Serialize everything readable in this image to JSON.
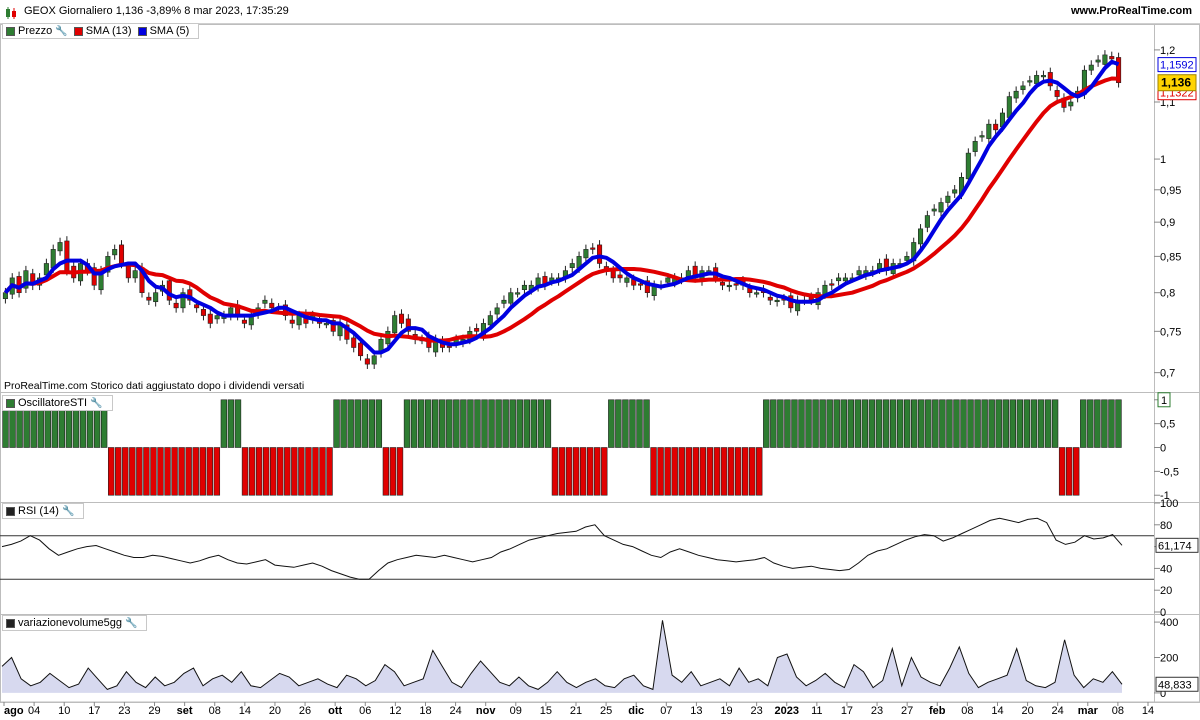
{
  "header": {
    "title": "GEOX Giornaliero 1,136 -3,89% 8 mar 2023, 17:35:29",
    "site": "www.ProRealTime.com"
  },
  "price_panel": {
    "legend": [
      {
        "label": "Prezzo",
        "color": "#2e7d32"
      },
      {
        "label": "SMA (13)",
        "color": "#e00000"
      },
      {
        "label": "SMA (5)",
        "color": "#0000e0"
      }
    ],
    "note": "ProRealTime.com  Storico dati aggiustato dopo i dividendi versati",
    "last_price": "1,136",
    "sma5_last": "1,1592",
    "sma13_last": "1,1322"
  },
  "sti_panel": {
    "legend": "OscillatoreSTI",
    "last_value": "1"
  },
  "rsi_panel": {
    "legend": "RSI (14)",
    "last_value": "61,174"
  },
  "volume_panel": {
    "legend": "variazionevolume5gg",
    "last_value": "48,833"
  },
  "x_axis": {
    "labels": [
      "ago",
      "04",
      "10",
      "17",
      "23",
      "29",
      "set",
      "08",
      "14",
      "20",
      "26",
      "ott",
      "06",
      "12",
      "18",
      "24",
      "nov",
      "09",
      "15",
      "21",
      "25",
      "dic",
      "07",
      "13",
      "19",
      "23",
      "2023",
      "11",
      "17",
      "23",
      "27",
      "feb",
      "08",
      "14",
      "20",
      "24",
      "mar",
      "08",
      "14"
    ]
  },
  "colors": {
    "up": "#2e7d32",
    "down": "#e00000",
    "sma13": "#e00000",
    "sma5": "#0000e0",
    "volume_fill": "#d7d9ef"
  },
  "chart_data": [
    {
      "type": "candlestick",
      "title": "GEOX Giornaliero",
      "y_ticks": [
        "1,2",
        "1,1",
        "1",
        "0,95",
        "0,9",
        "0,85",
        "0,8",
        "0,75",
        "0,7"
      ],
      "ylim": [
        0.68,
        1.22
      ],
      "y_scale": "log",
      "close": [
        0.8,
        0.82,
        0.8,
        0.83,
        0.81,
        0.82,
        0.84,
        0.86,
        0.87,
        0.83,
        0.82,
        0.84,
        0.83,
        0.81,
        0.83,
        0.85,
        0.86,
        0.84,
        0.82,
        0.83,
        0.8,
        0.79,
        0.8,
        0.81,
        0.79,
        0.78,
        0.8,
        0.79,
        0.78,
        0.77,
        0.76,
        0.77,
        0.77,
        0.78,
        0.77,
        0.76,
        0.77,
        0.78,
        0.79,
        0.78,
        0.78,
        0.77,
        0.76,
        0.77,
        0.76,
        0.77,
        0.76,
        0.76,
        0.75,
        0.76,
        0.74,
        0.73,
        0.72,
        0.71,
        0.72,
        0.74,
        0.75,
        0.77,
        0.76,
        0.75,
        0.74,
        0.74,
        0.73,
        0.74,
        0.73,
        0.73,
        0.74,
        0.74,
        0.75,
        0.75,
        0.76,
        0.77,
        0.78,
        0.79,
        0.8,
        0.8,
        0.81,
        0.81,
        0.82,
        0.81,
        0.82,
        0.82,
        0.83,
        0.84,
        0.85,
        0.86,
        0.86,
        0.84,
        0.83,
        0.82,
        0.82,
        0.82,
        0.81,
        0.81,
        0.8,
        0.81,
        0.81,
        0.82,
        0.82,
        0.82,
        0.83,
        0.82,
        0.83,
        0.83,
        0.82,
        0.81,
        0.81,
        0.81,
        0.81,
        0.8,
        0.8,
        0.8,
        0.79,
        0.79,
        0.79,
        0.78,
        0.79,
        0.79,
        0.79,
        0.8,
        0.81,
        0.81,
        0.82,
        0.82,
        0.82,
        0.83,
        0.83,
        0.83,
        0.84,
        0.83,
        0.84,
        0.84,
        0.85,
        0.87,
        0.89,
        0.91,
        0.92,
        0.93,
        0.94,
        0.95,
        0.97,
        1.01,
        1.03,
        1.04,
        1.06,
        1.05,
        1.08,
        1.11,
        1.12,
        1.13,
        1.14,
        1.15,
        1.15,
        1.13,
        1.11,
        1.09,
        1.1,
        1.12,
        1.16,
        1.17,
        1.18,
        1.19,
        1.182,
        1.136
      ],
      "sma13_last": 1.1322,
      "sma5_last": 1.1592
    },
    {
      "type": "bar",
      "title": "OscillatoreSTI",
      "y_ticks": [
        "1",
        "0,5",
        "0",
        "-0,5",
        "-1"
      ],
      "ylim": [
        -1.1,
        1.1
      ],
      "sign_runs": [
        [
          1,
          15
        ],
        [
          -1,
          16
        ],
        [
          1,
          3
        ],
        [
          -1,
          13
        ],
        [
          1,
          7
        ],
        [
          -1,
          3
        ],
        [
          1,
          21
        ],
        [
          -1,
          8
        ],
        [
          1,
          6
        ],
        [
          -1,
          16
        ],
        [
          1,
          42
        ],
        [
          -1,
          3
        ],
        [
          1,
          6
        ]
      ]
    },
    {
      "type": "line",
      "title": "RSI (14)",
      "y_ticks": [
        "100",
        "80",
        "60",
        "40",
        "20",
        "0"
      ],
      "ylim": [
        0,
        100
      ],
      "reference_lines": [
        70,
        30
      ],
      "values": [
        60,
        62,
        65,
        70,
        66,
        58,
        52,
        55,
        58,
        60,
        61,
        58,
        55,
        52,
        50,
        50,
        52,
        51,
        49,
        47,
        45,
        47,
        50,
        52,
        48,
        45,
        44,
        46,
        48,
        43,
        42,
        41,
        43,
        45,
        42,
        38,
        35,
        32,
        30,
        30,
        38,
        45,
        48,
        50,
        52,
        51,
        50,
        52,
        50,
        48,
        46,
        48,
        50,
        55,
        58,
        62,
        66,
        68,
        70,
        72,
        73,
        74,
        78,
        80,
        70,
        66,
        62,
        60,
        56,
        52,
        50,
        55,
        58,
        55,
        52,
        50,
        48,
        47,
        46,
        47,
        48,
        50,
        45,
        42,
        40,
        41,
        42,
        40,
        39,
        38,
        39,
        45,
        52,
        56,
        58,
        62,
        66,
        69,
        71,
        70,
        65,
        68,
        72,
        76,
        80,
        84,
        86,
        84,
        82,
        85,
        86,
        82,
        66,
        62,
        64,
        70,
        67,
        68,
        71,
        61.174
      ],
      "last_value": 61.174
    },
    {
      "type": "area",
      "title": "variazionevolume5gg",
      "y_ticks": [
        "400",
        "200",
        "0"
      ],
      "ylim": [
        -40,
        440
      ],
      "values": [
        150,
        200,
        80,
        40,
        60,
        110,
        70,
        30,
        50,
        140,
        80,
        20,
        40,
        120,
        60,
        30,
        90,
        40,
        60,
        110,
        140,
        40,
        80,
        100,
        60,
        120,
        40,
        30,
        70,
        110,
        90,
        40,
        60,
        80,
        50,
        30,
        100,
        80,
        40,
        70,
        160,
        120,
        40,
        60,
        80,
        240,
        150,
        60,
        30,
        110,
        180,
        120,
        60,
        40,
        90,
        40,
        20,
        60,
        120,
        60,
        30,
        60,
        80,
        40,
        30,
        80,
        100,
        40,
        20,
        410,
        100,
        60,
        120,
        40,
        60,
        80,
        40,
        140,
        60,
        80,
        40,
        200,
        220,
        90,
        40,
        70,
        110,
        60,
        30,
        160,
        120,
        30,
        70,
        250,
        40,
        200,
        90,
        60,
        40,
        140,
        260,
        110,
        30,
        60,
        80,
        100,
        250,
        70,
        40,
        30,
        60,
        300,
        100,
        30,
        80,
        60,
        120,
        48.833
      ],
      "last_value": 48.833
    }
  ]
}
